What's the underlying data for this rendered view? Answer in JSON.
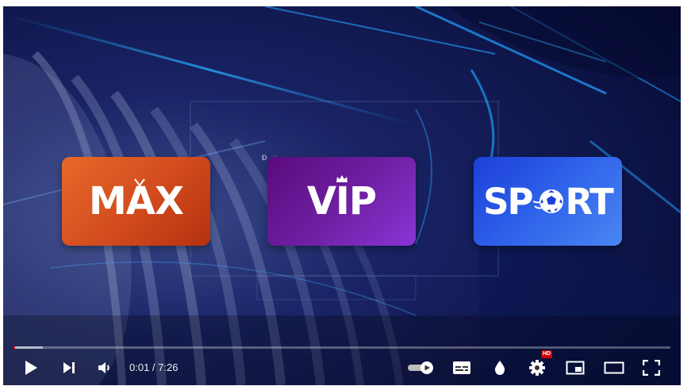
{
  "video": {
    "tiles": {
      "max": {
        "label": "MAX",
        "icon": "tv-antenna-icon"
      },
      "vip": {
        "label": "VIP",
        "icon": "crown-icon"
      },
      "sport": {
        "label_start": "SP",
        "label_end": "RT",
        "icon": "soccer-ball-icon"
      }
    },
    "stray_glyph": "Đ"
  },
  "player": {
    "progress": {
      "played_fraction": 0.0022,
      "buffered_fraction": 0.045
    },
    "time_display": "0:01 / 7:26",
    "hd_badge": "HD",
    "controls": [
      {
        "name": "play-button",
        "icon": "play-icon"
      },
      {
        "name": "next-button",
        "icon": "skip-next-icon"
      },
      {
        "name": "volume-button",
        "icon": "volume-icon"
      },
      {
        "name": "autoplay-toggle",
        "icon": "autoplay-toggle-icon"
      },
      {
        "name": "subtitles-button",
        "icon": "subtitles-icon"
      },
      {
        "name": "ambient-button",
        "icon": "droplet-icon"
      },
      {
        "name": "settings-button",
        "icon": "gear-icon"
      },
      {
        "name": "miniplayer-button",
        "icon": "miniplayer-icon"
      },
      {
        "name": "theater-button",
        "icon": "theater-mode-icon"
      },
      {
        "name": "fullscreen-button",
        "icon": "fullscreen-icon"
      }
    ]
  },
  "colors": {
    "progress_played": "#ff0000",
    "max_tile": "#d14a1d",
    "vip_tile": "#6d1fa0",
    "sport_tile": "#2f63ea",
    "hd_badge": "#cc0000"
  }
}
